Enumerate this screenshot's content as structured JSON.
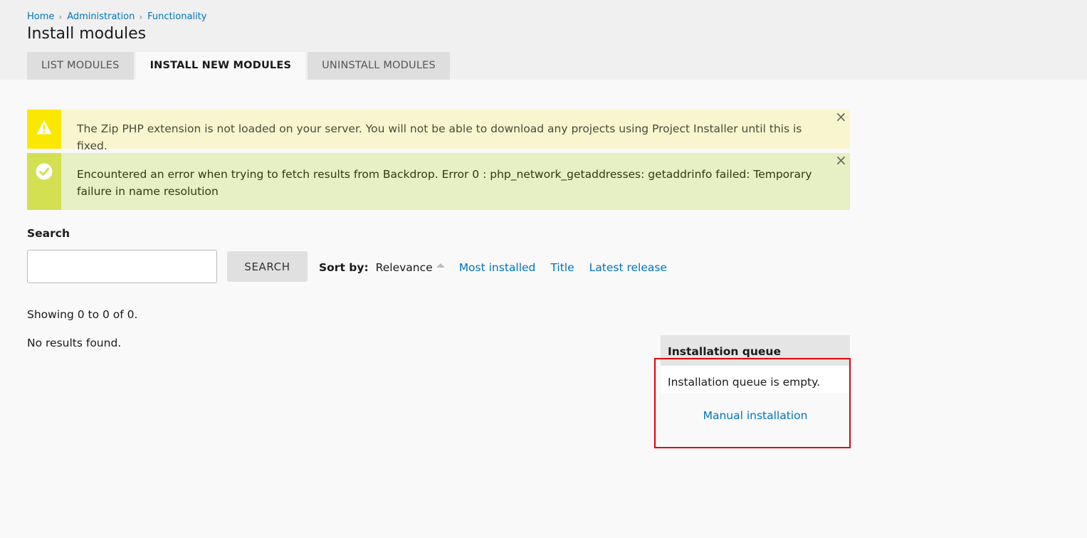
{
  "breadcrumb": [
    "Home",
    "Administration",
    "Functionality"
  ],
  "page_title": "Install modules",
  "tabs": [
    {
      "label": "LIST MODULES",
      "active": false
    },
    {
      "label": "INSTALL NEW MODULES",
      "active": true
    },
    {
      "label": "UNINSTALL MODULES",
      "active": false
    }
  ],
  "messages": {
    "warning": "The Zip PHP extension is not loaded on your server. You will not be able to download any projects using Project Installer until this is fixed.",
    "status": "Encountered an error when trying to fetch results from Backdrop. Error 0 : php_network_getaddresses: getaddrinfo failed: Temporary failure in name resolution",
    "close_symbol": "×"
  },
  "search": {
    "label": "Search",
    "value": "",
    "button_label": "SEARCH"
  },
  "sort": {
    "label": "Sort by:",
    "active": "Relevance",
    "options": [
      "Most installed",
      "Title",
      "Latest release"
    ]
  },
  "results": {
    "showing": "Showing 0 to 0 of 0.",
    "empty": "No results found."
  },
  "queue": {
    "title": "Installation queue",
    "empty_text": "Installation queue is empty.",
    "manual_link": "Manual installation"
  },
  "colors": {
    "link": "#0074bd",
    "warning_icon_bg": "#fbe800",
    "warning_bg": "#f9f6cf",
    "status_icon_bg": "#d2e052",
    "status_bg": "#e7efc4",
    "highlight": "#e0000b"
  },
  "icons": {
    "warning": "warning-triangle-icon",
    "status": "check-circle-icon",
    "close": "close-icon",
    "sort": "caret-up-icon",
    "breadcrumb_separator": "chevron-right-icon"
  }
}
